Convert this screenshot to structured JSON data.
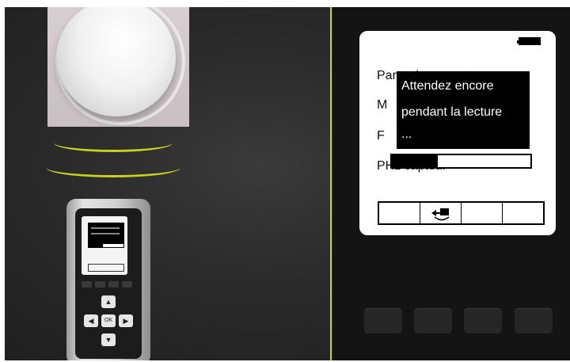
{
  "device_screen": {
    "menu_items": [
      "Paramètres capteur",
      "M",
      "F",
      "PHz capteur"
    ],
    "popup": {
      "lines": [
        "Attendez encore",
        "pendant la lecture",
        "..."
      ]
    },
    "progress_fraction": 0.33,
    "soft_keys": [
      "",
      "undo-arrow-icon",
      "",
      ""
    ]
  },
  "remote": {
    "dpad_center_label": "OK",
    "progress_fraction": 0.4
  },
  "colors": {
    "accent": "#c8d21e",
    "panel": "#141414",
    "background": "#2a2a2a"
  }
}
